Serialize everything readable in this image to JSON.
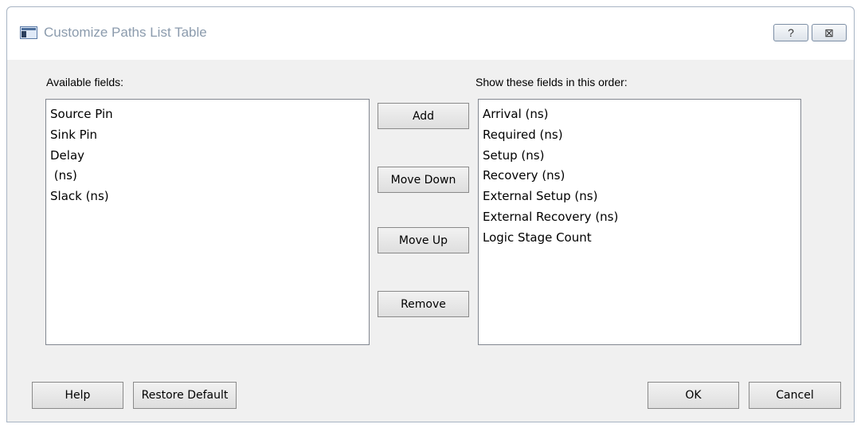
{
  "window": {
    "title": "Customize Paths List Table"
  },
  "titlebar": {
    "help_glyph": "?",
    "close_glyph": "⊠"
  },
  "available": {
    "label": "Available fields:",
    "items": [
      "Source Pin",
      "Sink Pin",
      "Delay",
      " (ns)",
      "Slack (ns)"
    ]
  },
  "selected": {
    "label": "Show these fields in this order:",
    "items": [
      "Arrival (ns)",
      "Required (ns)",
      "Setup (ns)",
      "Recovery (ns)",
      "External Setup (ns)",
      "External Recovery (ns)",
      "Logic Stage Count"
    ]
  },
  "middle_buttons": {
    "add": "Add",
    "move_down": "Move Down",
    "move_up": "Move Up",
    "remove": "Remove"
  },
  "footer": {
    "help": "Help",
    "restore_default": "Restore Default",
    "ok": "OK",
    "cancel": "Cancel"
  }
}
